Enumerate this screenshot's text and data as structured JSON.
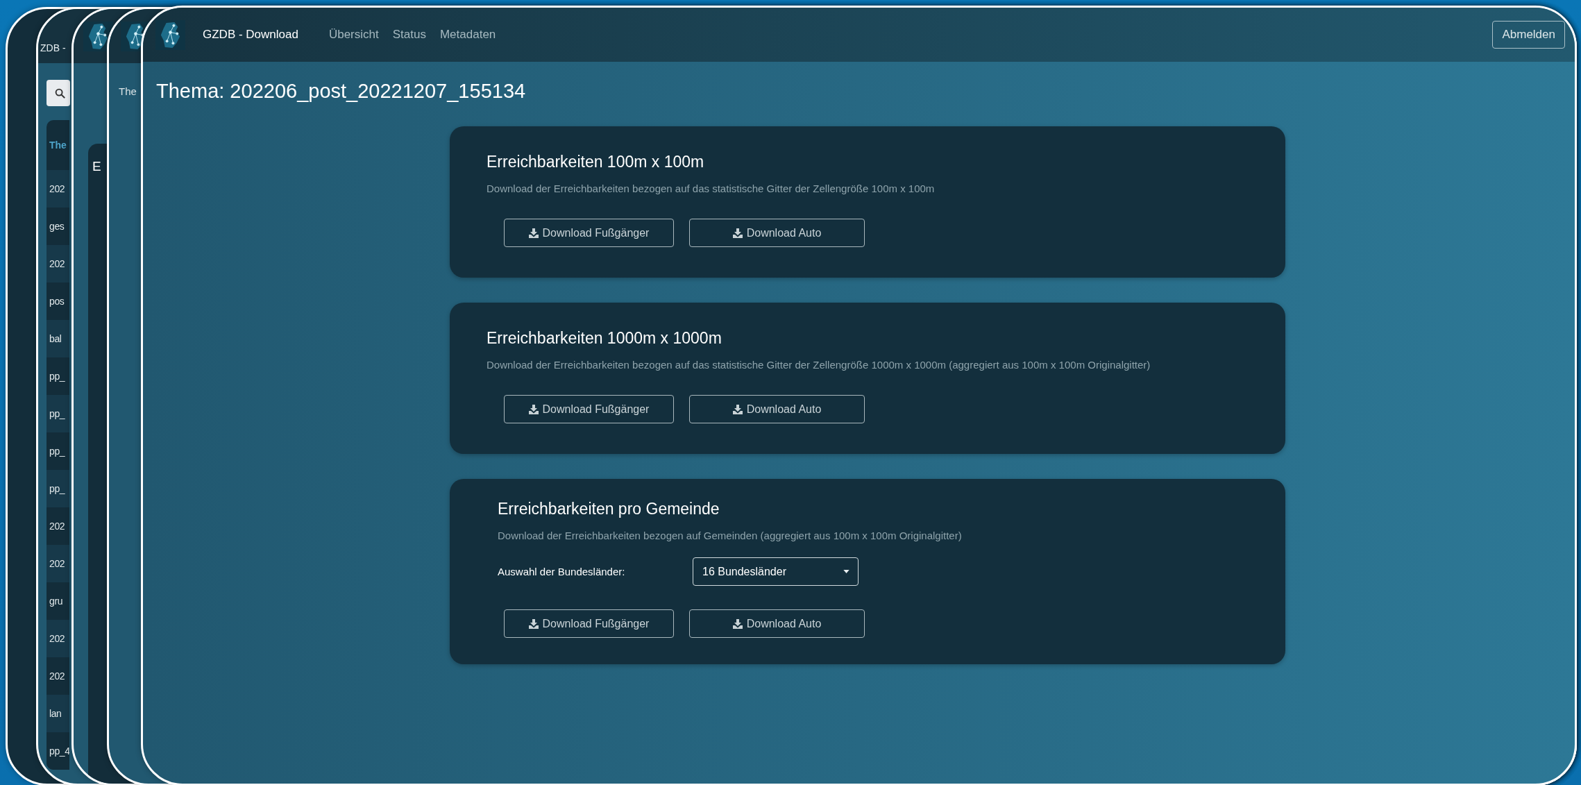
{
  "background_windows": [
    {
      "kind": "blank"
    },
    {
      "kind": "list",
      "app_title": "ZDB -",
      "list_header": "The",
      "items": [
        "202",
        "ges",
        "202",
        "pos",
        "bal",
        "pp_",
        "pp_",
        "pp_",
        "pp_",
        "202",
        "202",
        "gru",
        "202",
        "202",
        "lan",
        "pp_4"
      ]
    },
    {
      "kind": "card",
      "card_heading": "E"
    },
    {
      "kind": "heading",
      "heading": "The"
    }
  ],
  "window": {
    "app_title": "GZDB - Download",
    "nav": [
      "Übersicht",
      "Status",
      "Metadaten"
    ],
    "logout": "Abmelden",
    "heading": "Thema: 202206_post_20221207_155134",
    "cards": [
      {
        "kind": "plain",
        "title": "Erreichbarkeiten 100m x 100m",
        "description": "Download der Erreichbarkeiten bezogen auf das statistische Gitter der Zellengröße 100m x 100m",
        "buttons": [
          "Download Fußgänger",
          "Download Auto"
        ]
      },
      {
        "kind": "plain",
        "title": "Erreichbarkeiten 1000m x 1000m",
        "description": "Download der Erreichbarkeiten bezogen auf das statistische Gitter der Zellengröße 1000m x 1000m (aggregiert aus 100m x 100m Originalgitter)",
        "buttons": [
          "Download Fußgänger",
          "Download Auto"
        ]
      },
      {
        "kind": "select",
        "title": "Erreichbarkeiten pro Gemeinde",
        "description": "Download der Erreichbarkeiten bezogen auf Gemeinden (aggregiert aus 100m x 100m Originalgitter)",
        "select_label": "Auswahl der Bundesländer:",
        "select_value": "16 Bundesländer",
        "buttons": [
          "Download Fußgänger",
          "Download Auto"
        ]
      }
    ]
  }
}
